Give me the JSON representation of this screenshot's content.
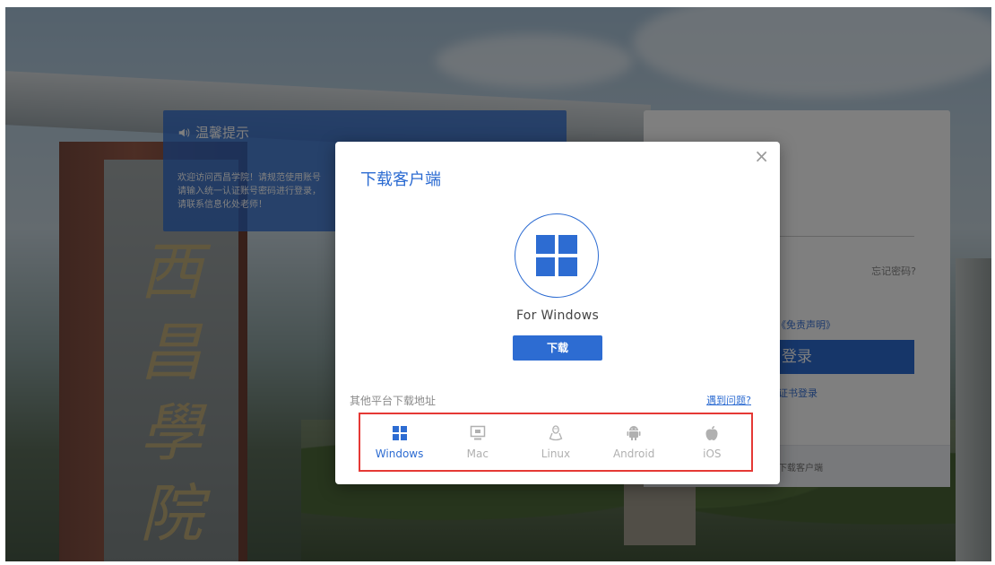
{
  "notice": {
    "title": "温馨提示",
    "body": "欢迎访问西昌学院！请规范使用账号\n请输入统一认证账号密码进行登录，\n请联系信息化处老师！"
  },
  "background": {
    "calligraphy": "西昌學院"
  },
  "login": {
    "forgot": "忘记密码?",
    "disclaimer": "《免责声明》",
    "login_button": "登录",
    "cert_login": "证书登录",
    "footer": "下载客户端"
  },
  "modal": {
    "title": "下载客户端",
    "close": "×",
    "platform_label": "For Windows",
    "download_button": "下载",
    "other_label": "其他平台下载地址",
    "problem_link": "遇到问题?",
    "platforms": [
      {
        "name": "Windows",
        "icon": "windows-icon",
        "active": true
      },
      {
        "name": "Mac",
        "icon": "mac-monitor-icon",
        "active": false
      },
      {
        "name": "Linux",
        "icon": "linux-penguin-icon",
        "active": false
      },
      {
        "name": "Android",
        "icon": "android-robot-icon",
        "active": false
      },
      {
        "name": "iOS",
        "icon": "apple-icon",
        "active": false
      }
    ]
  },
  "colors": {
    "accent": "#2d6cd2",
    "highlight_border": "#e53935",
    "inactive_text": "#b0b0b0"
  }
}
